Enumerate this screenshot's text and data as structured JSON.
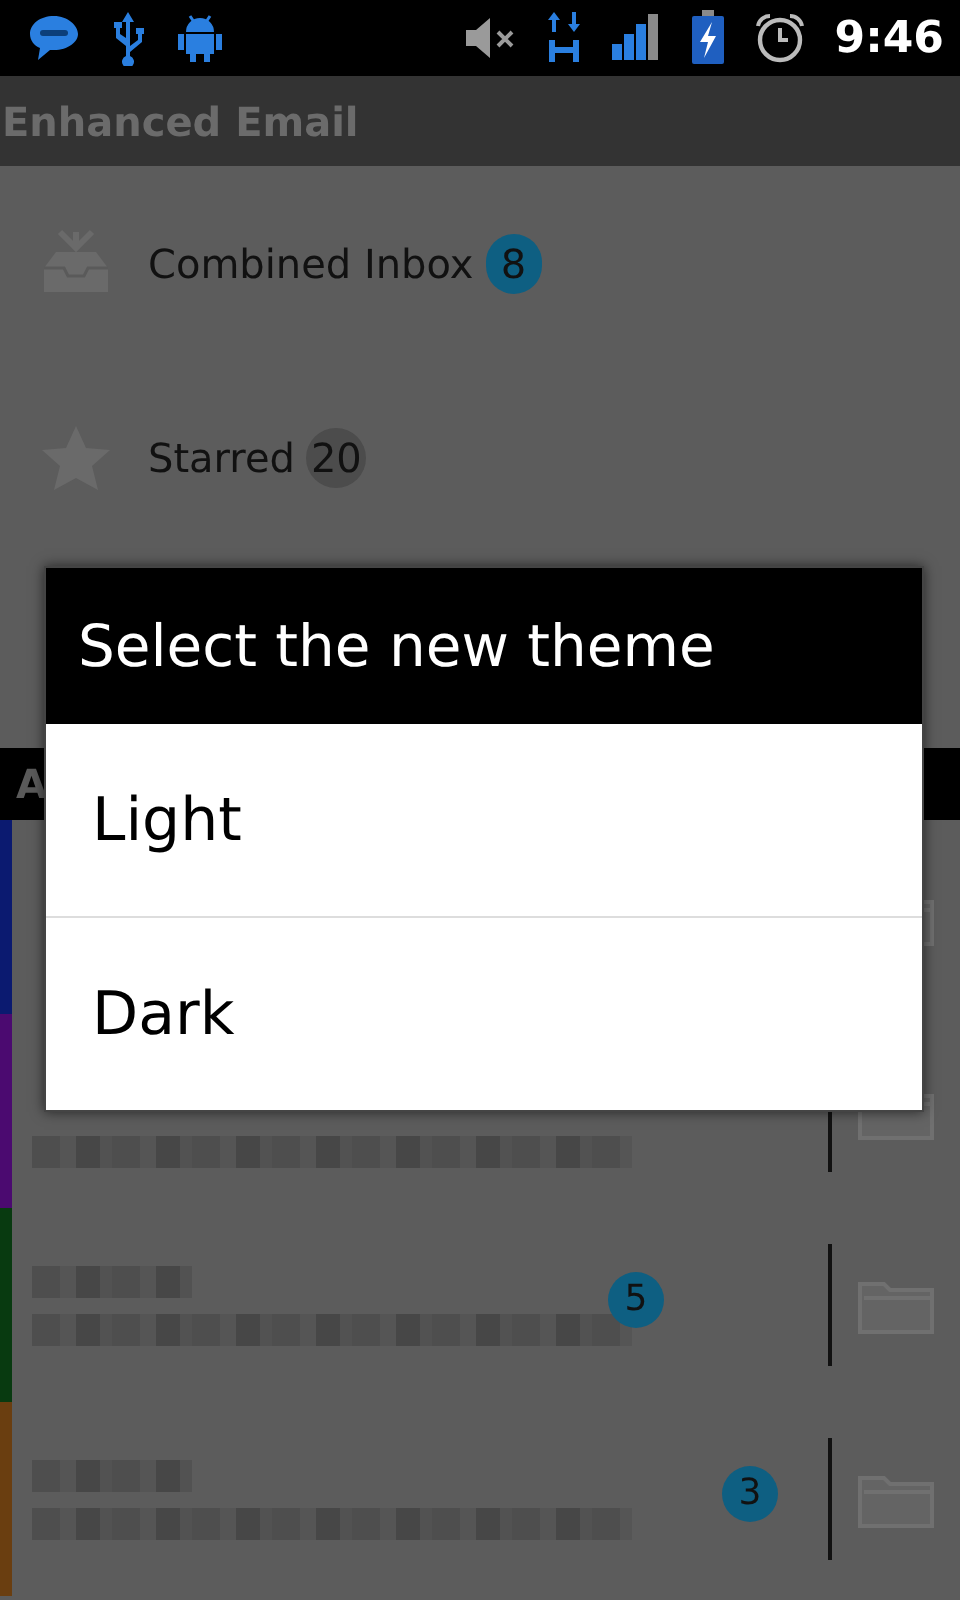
{
  "status_bar": {
    "time": "9:46"
  },
  "app_bar": {
    "title": "Enhanced Email"
  },
  "folders": [
    {
      "kind": "inbox",
      "label": "Combined Inbox",
      "count": "8",
      "color": "#0e5f82"
    },
    {
      "kind": "starred",
      "label": "Starred",
      "count": "20",
      "color": "#4c4c4c"
    }
  ],
  "section_header": {
    "title": "A"
  },
  "accounts": [
    {
      "color": "#0b1a70"
    },
    {
      "color": "#4b0a70"
    },
    {
      "color": "#083a10",
      "count": "5"
    },
    {
      "color": "#6a3e10",
      "count": "3"
    }
  ],
  "dialog": {
    "title": "Select the new theme",
    "options": [
      {
        "label": "Light"
      },
      {
        "label": "Dark"
      }
    ]
  }
}
